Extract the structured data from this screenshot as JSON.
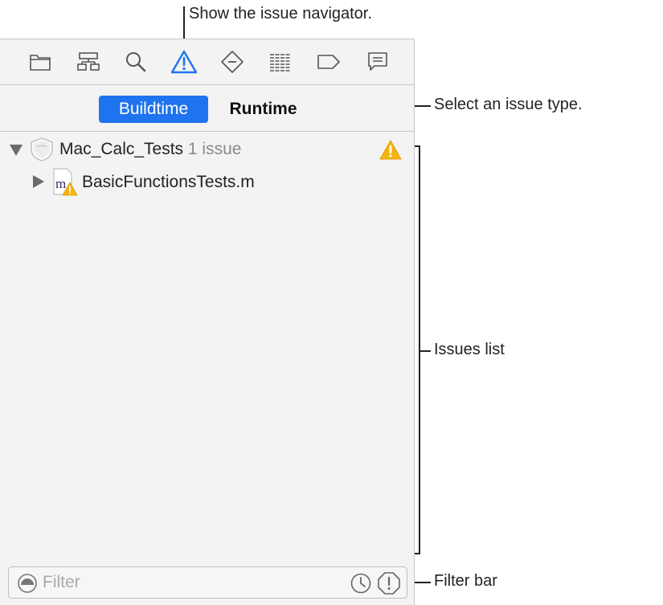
{
  "callouts": {
    "show_navigator": "Show the issue navigator.",
    "select_type": "Select an issue type.",
    "issues_list": "Issues list",
    "filter_bar": "Filter bar"
  },
  "toolbar": {
    "icons": [
      "folder-icon",
      "hierarchy-icon",
      "search-icon",
      "warning-icon",
      "test-diamond-icon",
      "list-lines-icon",
      "tag-icon",
      "comment-icon"
    ],
    "active_index": 3,
    "accent_color": "#1f73ee"
  },
  "segments": {
    "buildtime": "Buildtime",
    "runtime": "Runtime",
    "selected": "Buildtime"
  },
  "tree": {
    "project": {
      "name": "Mac_Calc_Tests",
      "count": "1 issue",
      "expanded": true
    },
    "file": {
      "name": "BasicFunctionsTests.m",
      "expanded": false
    }
  },
  "filter": {
    "placeholder": "Filter",
    "value": ""
  },
  "colors": {
    "warning": "#f5b50e",
    "panel_bg": "#f3f3f3"
  }
}
